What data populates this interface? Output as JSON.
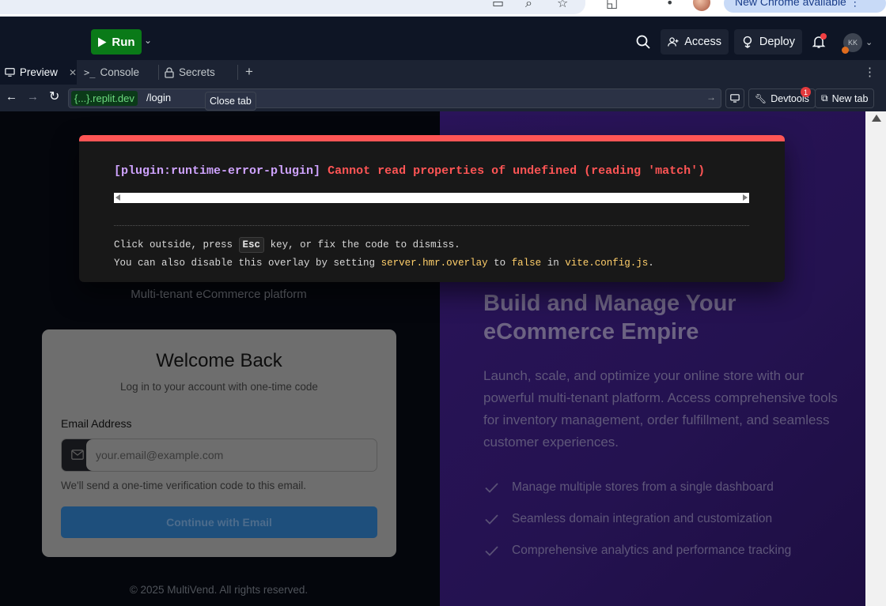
{
  "browser": {
    "update_banner": "New Chrome available"
  },
  "topbar": {
    "run_label": "Run",
    "access_label": "Access",
    "deploy_label": "Deploy",
    "user_initials": "KK"
  },
  "tabs": [
    {
      "label": "Preview"
    },
    {
      "label": "Console"
    },
    {
      "label": "Secrets"
    }
  ],
  "urlbar": {
    "host": "{...}.replit.dev",
    "path": "/login",
    "tooltip": "Close tab",
    "devtools_label": "Devtools",
    "devtools_badge": "1",
    "new_tab_label": "New tab"
  },
  "overlay": {
    "plugin": "[plugin:runtime-error-plugin]",
    "message": "Cannot read properties of undefined (reading 'match')",
    "tip_prefix": "Click outside, press",
    "tip_key": "Esc",
    "tip_suffix": "key, or fix the code to dismiss.",
    "tip2_prefix": "You can also disable this overlay by setting",
    "tip2_code1": "server.hmr.overlay",
    "tip2_mid": "to",
    "tip2_code2": "false",
    "tip2_in": "in",
    "tip2_code3": "vite.config.js",
    "tip2_end": "."
  },
  "login": {
    "tagline": "Multi-tenant eCommerce platform",
    "title": "Welcome Back",
    "subtitle": "Log in to your account with one-time code",
    "email_label": "Email Address",
    "email_placeholder": "your.email@example.com",
    "hint": "We'll send a one-time verification code to this email.",
    "continue_label": "Continue with Email",
    "copyright": "© 2025 MultiVend. All rights reserved."
  },
  "hero": {
    "title_line1": "Build and Manage Your",
    "title_line2": "eCommerce Empire",
    "description": "Launch, scale, and optimize your online store with our powerful multi-tenant platform. Access comprehensive tools for inventory management, order fulfillment, and seamless customer experiences.",
    "features": [
      "Manage multiple stores from a single dashboard",
      "Seamless domain integration and customization",
      "Comprehensive analytics and performance tracking"
    ]
  },
  "colors": {
    "run_green": "#0a7a18",
    "error_red": "#ff5555",
    "hero_purple": "#2a145a"
  }
}
